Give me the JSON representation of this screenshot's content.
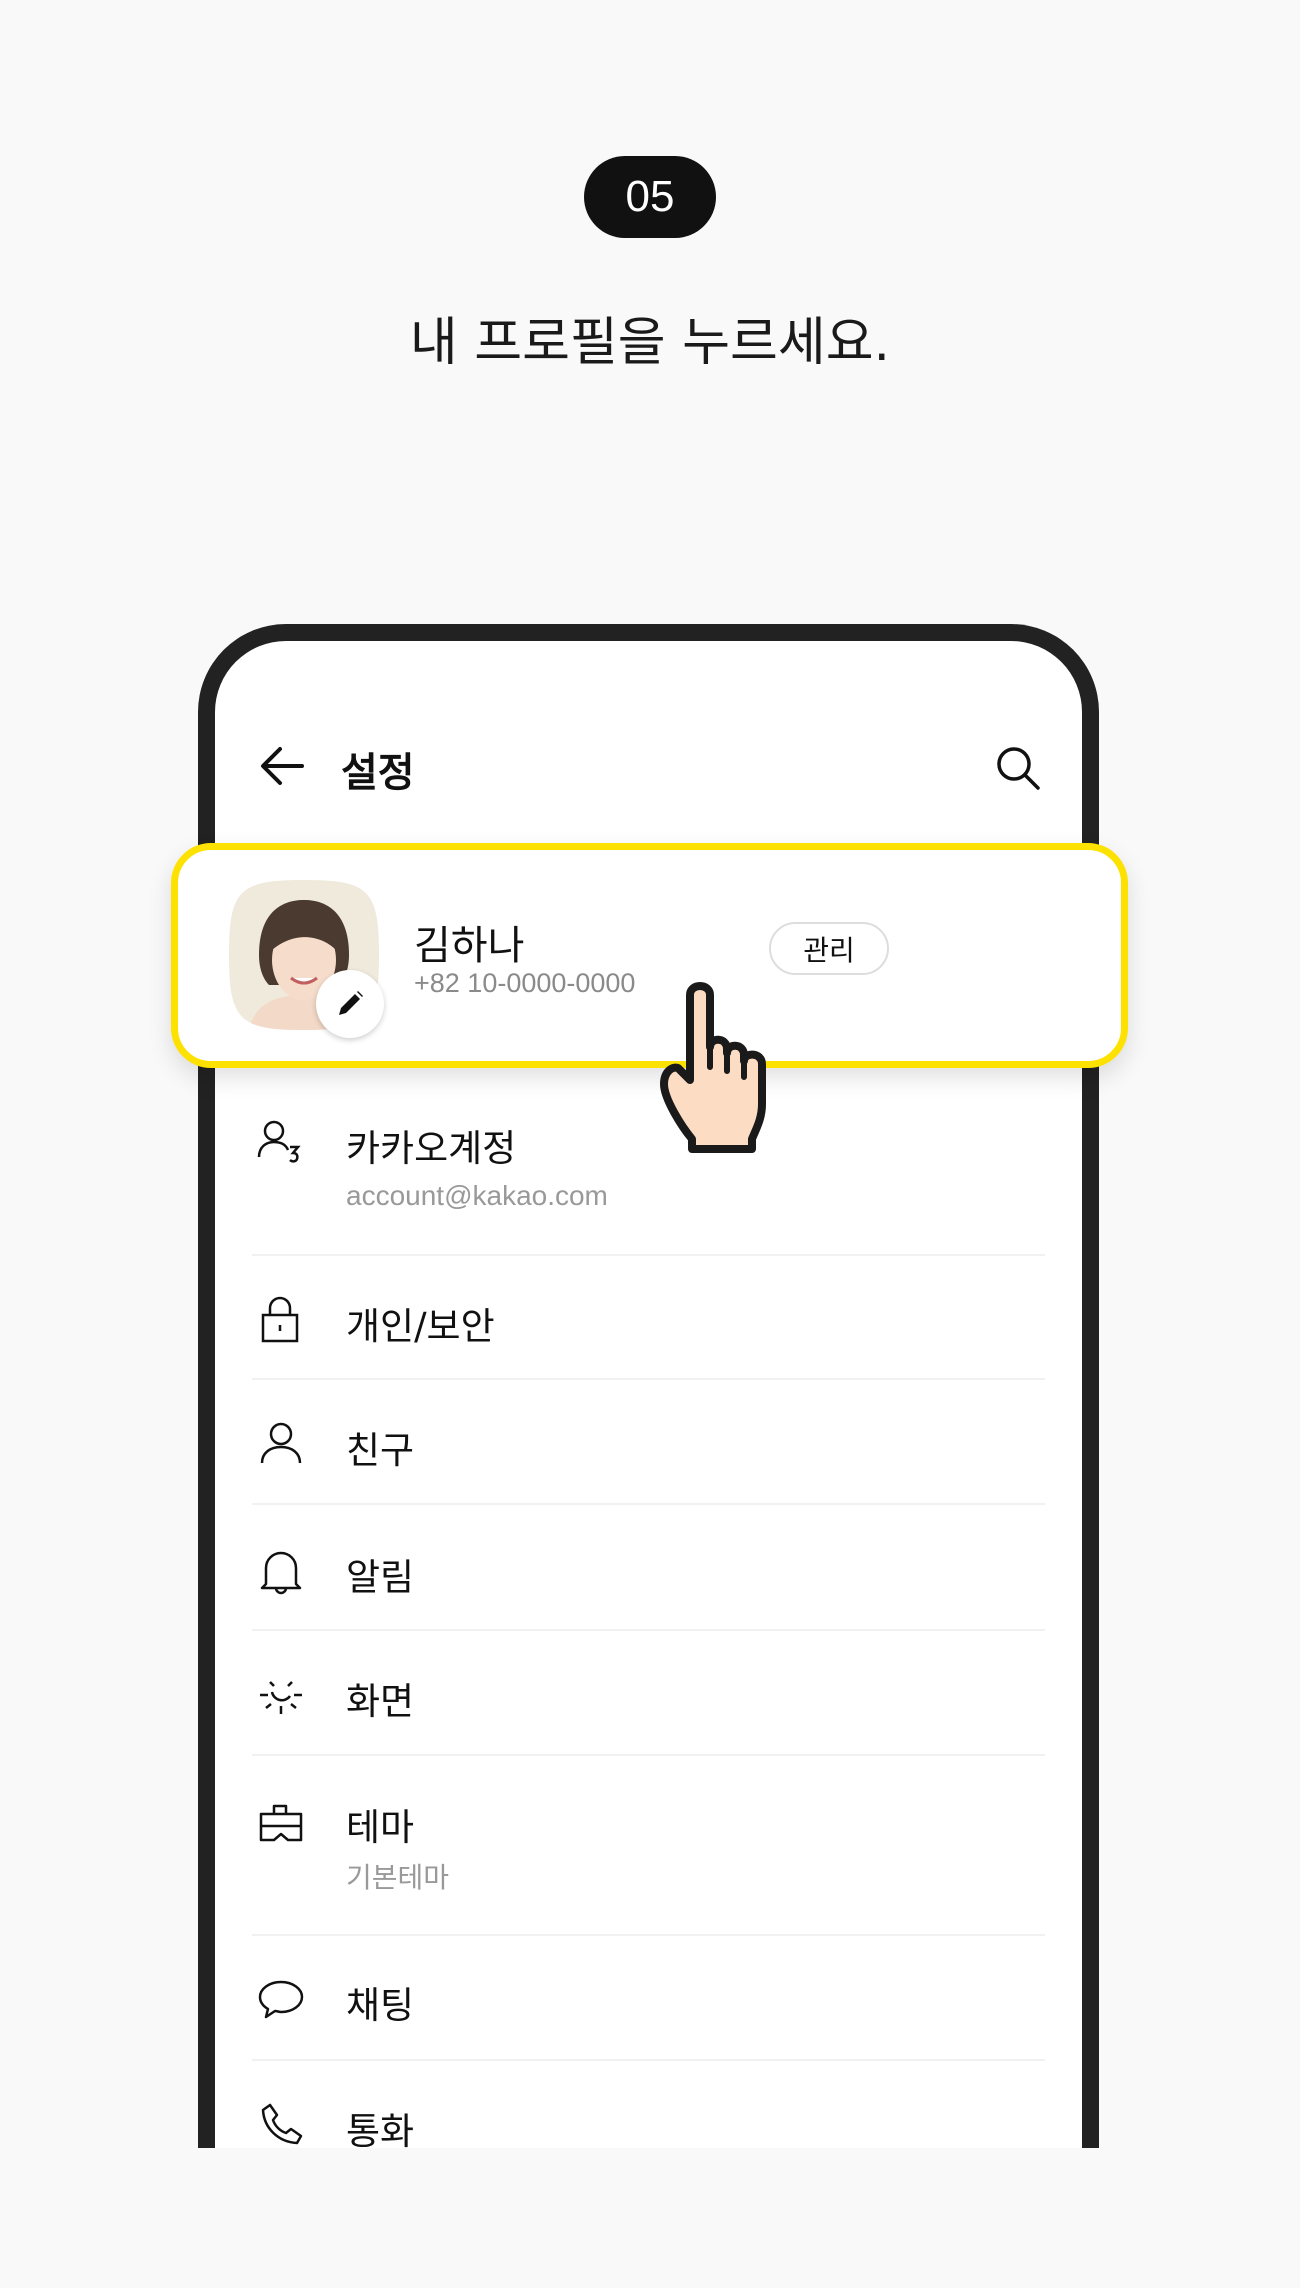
{
  "step": {
    "number": "05",
    "instruction": "내 프로필을 누르세요."
  },
  "header": {
    "title": "설정",
    "back_icon": "arrow-left-icon",
    "search_icon": "search-icon"
  },
  "profile": {
    "name": "김하나",
    "phone": "+82 10-0000-0000",
    "manage_label": "관리",
    "highlight_color": "#fde100"
  },
  "settings": {
    "items": [
      {
        "label": "카카오계정",
        "sub": "account@kakao.com",
        "icon": "account-icon"
      },
      {
        "label": "개인/보안",
        "icon": "lock-icon"
      },
      {
        "label": "친구",
        "icon": "person-icon"
      },
      {
        "label": "알림",
        "icon": "bell-icon"
      },
      {
        "label": "화면",
        "icon": "sun-icon"
      },
      {
        "label": "테마",
        "sub": "기본테마",
        "icon": "theme-icon"
      },
      {
        "label": "채팅",
        "icon": "chat-bubble-icon"
      },
      {
        "label": "통화",
        "icon": "phone-icon"
      }
    ]
  }
}
